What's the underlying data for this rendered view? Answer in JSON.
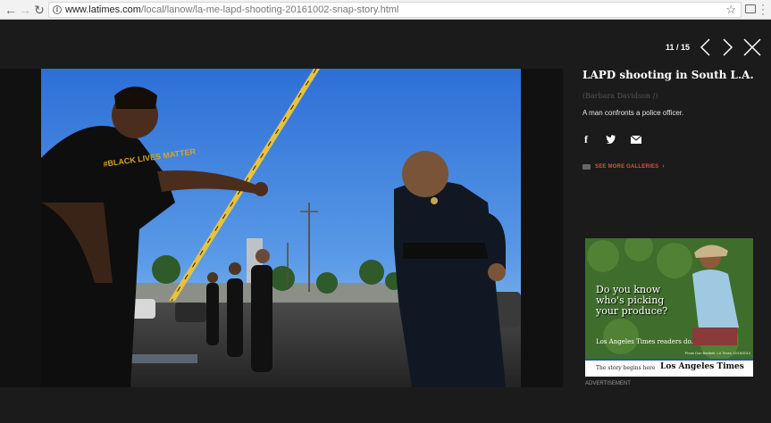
{
  "browser": {
    "url_host": "www.latimes.com",
    "url_path": "/local/lanow/la-me-lapd-shooting-20161002-snap-story.html",
    "info_icon": "info-icon",
    "bookmark_icon": "star-icon"
  },
  "gallery": {
    "counter": "11 / 15",
    "title": "LAPD shooting in South L.A.",
    "credit": "(Barbara Davidson /)",
    "description": "A man confronts a police officer.",
    "share_icons": [
      "facebook-icon",
      "twitter-icon",
      "email-icon"
    ],
    "more_galleries": "SEE MORE GALLERIES",
    "accent_color": "#d9533d"
  },
  "ad": {
    "headline_line1": "Do you know",
    "headline_line2": "who's picking",
    "headline_line3": "your produce?",
    "readers": "Los Angeles Times readers do.",
    "photo_credit": "Photo Don Bartletti, LA Times 12/16/2014",
    "tagline": "The story begins here",
    "brand": "Los Angeles Times",
    "label": "ADVERTISEMENT"
  },
  "photo": {
    "shirt_text": "#BLACK LIVES MATTER"
  }
}
